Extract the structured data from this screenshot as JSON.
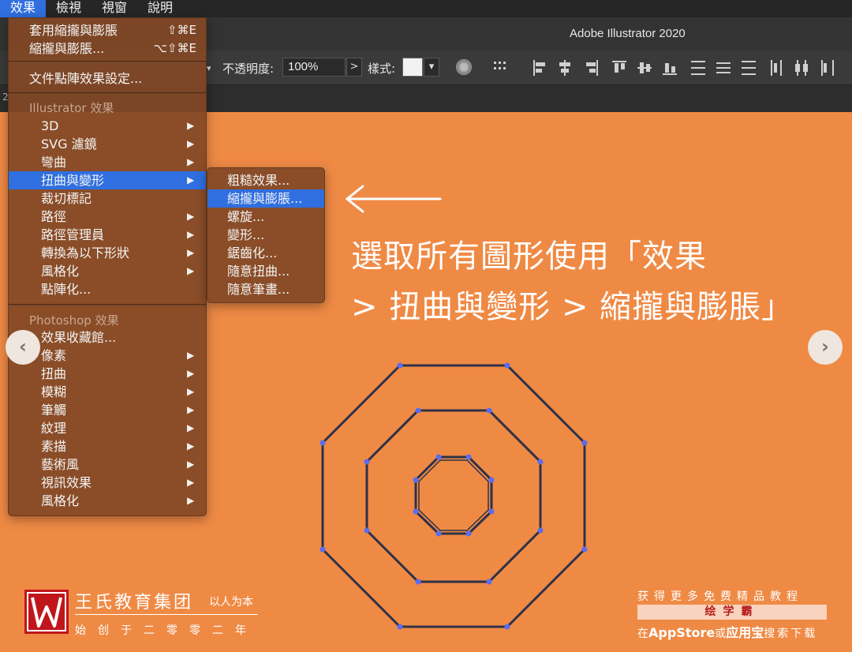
{
  "menubar": {
    "items": [
      "效果",
      "檢視",
      "視窗",
      "說明"
    ]
  },
  "app": {
    "title": "Adobe Illustrator 2020"
  },
  "controlbar": {
    "opacity_label": "不透明度:",
    "opacity_value": "100%",
    "style_label": "樣式:",
    "more_arrow": ">"
  },
  "doc": {
    "num": "2"
  },
  "effect_menu": {
    "apply_last": {
      "label": "套用縮攏與膨脹",
      "shortcut": "⇧⌘E"
    },
    "last_effect": {
      "label": "縮攏與膨脹...",
      "shortcut": "⌥⇧⌘E"
    },
    "raster_settings": "文件點陣效果設定...",
    "illustrator_header": "Illustrator 效果",
    "illustrator_items": [
      "3D",
      "SVG 濾鏡",
      "彎曲",
      "扭曲與變形",
      "裁切標記",
      "路徑",
      "路徑管理員",
      "轉換為以下形狀",
      "風格化",
      "點陣化..."
    ],
    "photoshop_header": "Photoshop 效果",
    "photoshop_items": [
      "效果收藏館...",
      "像素",
      "扭曲",
      "模糊",
      "筆觸",
      "紋理",
      "素描",
      "藝術風",
      "視訊效果",
      "風格化"
    ]
  },
  "submenu": {
    "items": [
      "粗糙效果...",
      "縮攏與膨脹...",
      "螺旋...",
      "變形...",
      "鋸齒化...",
      "隨意扭曲...",
      "隨意筆畫..."
    ]
  },
  "instruction": {
    "line1": "選取所有圖形使用「效果",
    "line2": "> 扭曲與變形 > 縮攏與膨脹」"
  },
  "nav": {
    "prev": "‹",
    "next": "›"
  },
  "watermark": {
    "brand": "王氏教育集团",
    "slogan": "以人为本",
    "founded": "始创于二零零二年",
    "promo_line1": "获得更多免费精品教程",
    "promo_app": "绘学霸",
    "promo_pre": "在",
    "promo_store": "AppStore",
    "promo_or": "或",
    "promo_yyb": "应用宝",
    "promo_post": "搜索下载"
  },
  "colors": {
    "canvas": "#ef8a45",
    "highlight": "#2f6fe0",
    "path": "#2f3147",
    "anchor": "#5b6cf0",
    "logo": "#c0161b"
  }
}
